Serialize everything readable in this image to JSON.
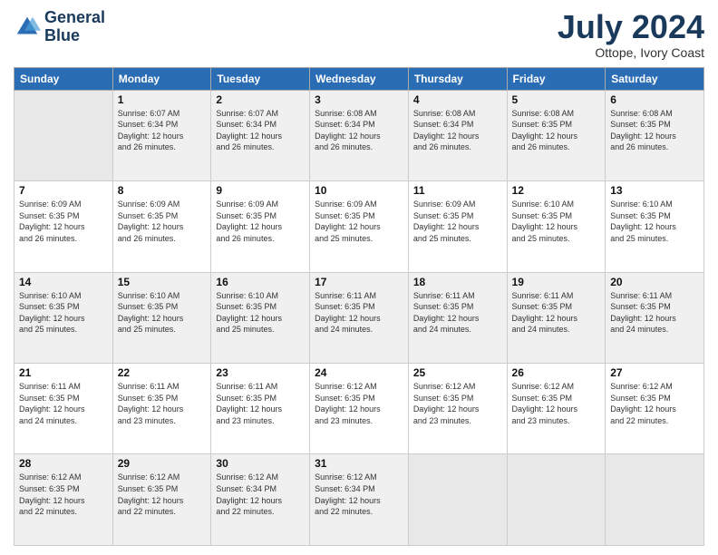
{
  "header": {
    "logo_line1": "General",
    "logo_line2": "Blue",
    "title": "July 2024",
    "subtitle": "Ottope, Ivory Coast"
  },
  "weekdays": [
    "Sunday",
    "Monday",
    "Tuesday",
    "Wednesday",
    "Thursday",
    "Friday",
    "Saturday"
  ],
  "weeks": [
    [
      {
        "day": "",
        "sunrise": "",
        "sunset": "",
        "daylight": ""
      },
      {
        "day": "1",
        "sunrise": "Sunrise: 6:07 AM",
        "sunset": "Sunset: 6:34 PM",
        "daylight": "Daylight: 12 hours and 26 minutes."
      },
      {
        "day": "2",
        "sunrise": "Sunrise: 6:07 AM",
        "sunset": "Sunset: 6:34 PM",
        "daylight": "Daylight: 12 hours and 26 minutes."
      },
      {
        "day": "3",
        "sunrise": "Sunrise: 6:08 AM",
        "sunset": "Sunset: 6:34 PM",
        "daylight": "Daylight: 12 hours and 26 minutes."
      },
      {
        "day": "4",
        "sunrise": "Sunrise: 6:08 AM",
        "sunset": "Sunset: 6:34 PM",
        "daylight": "Daylight: 12 hours and 26 minutes."
      },
      {
        "day": "5",
        "sunrise": "Sunrise: 6:08 AM",
        "sunset": "Sunset: 6:35 PM",
        "daylight": "Daylight: 12 hours and 26 minutes."
      },
      {
        "day": "6",
        "sunrise": "Sunrise: 6:08 AM",
        "sunset": "Sunset: 6:35 PM",
        "daylight": "Daylight: 12 hours and 26 minutes."
      }
    ],
    [
      {
        "day": "7",
        "sunrise": "Sunrise: 6:09 AM",
        "sunset": "Sunset: 6:35 PM",
        "daylight": "Daylight: 12 hours and 26 minutes."
      },
      {
        "day": "8",
        "sunrise": "Sunrise: 6:09 AM",
        "sunset": "Sunset: 6:35 PM",
        "daylight": "Daylight: 12 hours and 26 minutes."
      },
      {
        "day": "9",
        "sunrise": "Sunrise: 6:09 AM",
        "sunset": "Sunset: 6:35 PM",
        "daylight": "Daylight: 12 hours and 26 minutes."
      },
      {
        "day": "10",
        "sunrise": "Sunrise: 6:09 AM",
        "sunset": "Sunset: 6:35 PM",
        "daylight": "Daylight: 12 hours and 25 minutes."
      },
      {
        "day": "11",
        "sunrise": "Sunrise: 6:09 AM",
        "sunset": "Sunset: 6:35 PM",
        "daylight": "Daylight: 12 hours and 25 minutes."
      },
      {
        "day": "12",
        "sunrise": "Sunrise: 6:10 AM",
        "sunset": "Sunset: 6:35 PM",
        "daylight": "Daylight: 12 hours and 25 minutes."
      },
      {
        "day": "13",
        "sunrise": "Sunrise: 6:10 AM",
        "sunset": "Sunset: 6:35 PM",
        "daylight": "Daylight: 12 hours and 25 minutes."
      }
    ],
    [
      {
        "day": "14",
        "sunrise": "Sunrise: 6:10 AM",
        "sunset": "Sunset: 6:35 PM",
        "daylight": "Daylight: 12 hours and 25 minutes."
      },
      {
        "day": "15",
        "sunrise": "Sunrise: 6:10 AM",
        "sunset": "Sunset: 6:35 PM",
        "daylight": "Daylight: 12 hours and 25 minutes."
      },
      {
        "day": "16",
        "sunrise": "Sunrise: 6:10 AM",
        "sunset": "Sunset: 6:35 PM",
        "daylight": "Daylight: 12 hours and 25 minutes."
      },
      {
        "day": "17",
        "sunrise": "Sunrise: 6:11 AM",
        "sunset": "Sunset: 6:35 PM",
        "daylight": "Daylight: 12 hours and 24 minutes."
      },
      {
        "day": "18",
        "sunrise": "Sunrise: 6:11 AM",
        "sunset": "Sunset: 6:35 PM",
        "daylight": "Daylight: 12 hours and 24 minutes."
      },
      {
        "day": "19",
        "sunrise": "Sunrise: 6:11 AM",
        "sunset": "Sunset: 6:35 PM",
        "daylight": "Daylight: 12 hours and 24 minutes."
      },
      {
        "day": "20",
        "sunrise": "Sunrise: 6:11 AM",
        "sunset": "Sunset: 6:35 PM",
        "daylight": "Daylight: 12 hours and 24 minutes."
      }
    ],
    [
      {
        "day": "21",
        "sunrise": "Sunrise: 6:11 AM",
        "sunset": "Sunset: 6:35 PM",
        "daylight": "Daylight: 12 hours and 24 minutes."
      },
      {
        "day": "22",
        "sunrise": "Sunrise: 6:11 AM",
        "sunset": "Sunset: 6:35 PM",
        "daylight": "Daylight: 12 hours and 23 minutes."
      },
      {
        "day": "23",
        "sunrise": "Sunrise: 6:11 AM",
        "sunset": "Sunset: 6:35 PM",
        "daylight": "Daylight: 12 hours and 23 minutes."
      },
      {
        "day": "24",
        "sunrise": "Sunrise: 6:12 AM",
        "sunset": "Sunset: 6:35 PM",
        "daylight": "Daylight: 12 hours and 23 minutes."
      },
      {
        "day": "25",
        "sunrise": "Sunrise: 6:12 AM",
        "sunset": "Sunset: 6:35 PM",
        "daylight": "Daylight: 12 hours and 23 minutes."
      },
      {
        "day": "26",
        "sunrise": "Sunrise: 6:12 AM",
        "sunset": "Sunset: 6:35 PM",
        "daylight": "Daylight: 12 hours and 23 minutes."
      },
      {
        "day": "27",
        "sunrise": "Sunrise: 6:12 AM",
        "sunset": "Sunset: 6:35 PM",
        "daylight": "Daylight: 12 hours and 22 minutes."
      }
    ],
    [
      {
        "day": "28",
        "sunrise": "Sunrise: 6:12 AM",
        "sunset": "Sunset: 6:35 PM",
        "daylight": "Daylight: 12 hours and 22 minutes."
      },
      {
        "day": "29",
        "sunrise": "Sunrise: 6:12 AM",
        "sunset": "Sunset: 6:35 PM",
        "daylight": "Daylight: 12 hours and 22 minutes."
      },
      {
        "day": "30",
        "sunrise": "Sunrise: 6:12 AM",
        "sunset": "Sunset: 6:34 PM",
        "daylight": "Daylight: 12 hours and 22 minutes."
      },
      {
        "day": "31",
        "sunrise": "Sunrise: 6:12 AM",
        "sunset": "Sunset: 6:34 PM",
        "daylight": "Daylight: 12 hours and 22 minutes."
      },
      {
        "day": "",
        "sunrise": "",
        "sunset": "",
        "daylight": ""
      },
      {
        "day": "",
        "sunrise": "",
        "sunset": "",
        "daylight": ""
      },
      {
        "day": "",
        "sunrise": "",
        "sunset": "",
        "daylight": ""
      }
    ]
  ]
}
